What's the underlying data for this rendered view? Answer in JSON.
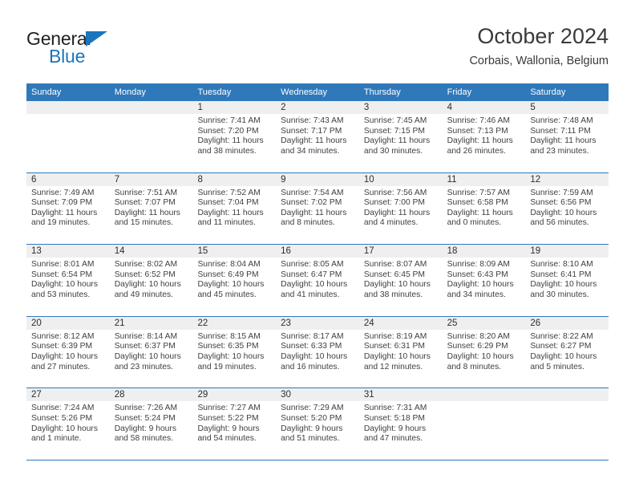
{
  "brand": {
    "name_part1": "General",
    "name_part2": "Blue",
    "accent_color": "#1b75bc",
    "logo_icon": "triangle-flag-icon"
  },
  "header": {
    "title": "October 2024",
    "subtitle": "Corbais, Wallonia, Belgium"
  },
  "calendar": {
    "header_color": "#2f78ba",
    "weekdays": [
      "Sunday",
      "Monday",
      "Tuesday",
      "Wednesday",
      "Thursday",
      "Friday",
      "Saturday"
    ],
    "weeks": [
      [
        {
          "day": "",
          "sunrise": "",
          "sunset": "",
          "daylight": "",
          "daylight2": ""
        },
        {
          "day": "",
          "sunrise": "",
          "sunset": "",
          "daylight": "",
          "daylight2": ""
        },
        {
          "day": "1",
          "sunrise": "Sunrise: 7:41 AM",
          "sunset": "Sunset: 7:20 PM",
          "daylight": "Daylight: 11 hours",
          "daylight2": "and 38 minutes."
        },
        {
          "day": "2",
          "sunrise": "Sunrise: 7:43 AM",
          "sunset": "Sunset: 7:17 PM",
          "daylight": "Daylight: 11 hours",
          "daylight2": "and 34 minutes."
        },
        {
          "day": "3",
          "sunrise": "Sunrise: 7:45 AM",
          "sunset": "Sunset: 7:15 PM",
          "daylight": "Daylight: 11 hours",
          "daylight2": "and 30 minutes."
        },
        {
          "day": "4",
          "sunrise": "Sunrise: 7:46 AM",
          "sunset": "Sunset: 7:13 PM",
          "daylight": "Daylight: 11 hours",
          "daylight2": "and 26 minutes."
        },
        {
          "day": "5",
          "sunrise": "Sunrise: 7:48 AM",
          "sunset": "Sunset: 7:11 PM",
          "daylight": "Daylight: 11 hours",
          "daylight2": "and 23 minutes."
        }
      ],
      [
        {
          "day": "6",
          "sunrise": "Sunrise: 7:49 AM",
          "sunset": "Sunset: 7:09 PM",
          "daylight": "Daylight: 11 hours",
          "daylight2": "and 19 minutes."
        },
        {
          "day": "7",
          "sunrise": "Sunrise: 7:51 AM",
          "sunset": "Sunset: 7:07 PM",
          "daylight": "Daylight: 11 hours",
          "daylight2": "and 15 minutes."
        },
        {
          "day": "8",
          "sunrise": "Sunrise: 7:52 AM",
          "sunset": "Sunset: 7:04 PM",
          "daylight": "Daylight: 11 hours",
          "daylight2": "and 11 minutes."
        },
        {
          "day": "9",
          "sunrise": "Sunrise: 7:54 AM",
          "sunset": "Sunset: 7:02 PM",
          "daylight": "Daylight: 11 hours",
          "daylight2": "and 8 minutes."
        },
        {
          "day": "10",
          "sunrise": "Sunrise: 7:56 AM",
          "sunset": "Sunset: 7:00 PM",
          "daylight": "Daylight: 11 hours",
          "daylight2": "and 4 minutes."
        },
        {
          "day": "11",
          "sunrise": "Sunrise: 7:57 AM",
          "sunset": "Sunset: 6:58 PM",
          "daylight": "Daylight: 11 hours",
          "daylight2": "and 0 minutes."
        },
        {
          "day": "12",
          "sunrise": "Sunrise: 7:59 AM",
          "sunset": "Sunset: 6:56 PM",
          "daylight": "Daylight: 10 hours",
          "daylight2": "and 56 minutes."
        }
      ],
      [
        {
          "day": "13",
          "sunrise": "Sunrise: 8:01 AM",
          "sunset": "Sunset: 6:54 PM",
          "daylight": "Daylight: 10 hours",
          "daylight2": "and 53 minutes."
        },
        {
          "day": "14",
          "sunrise": "Sunrise: 8:02 AM",
          "sunset": "Sunset: 6:52 PM",
          "daylight": "Daylight: 10 hours",
          "daylight2": "and 49 minutes."
        },
        {
          "day": "15",
          "sunrise": "Sunrise: 8:04 AM",
          "sunset": "Sunset: 6:49 PM",
          "daylight": "Daylight: 10 hours",
          "daylight2": "and 45 minutes."
        },
        {
          "day": "16",
          "sunrise": "Sunrise: 8:05 AM",
          "sunset": "Sunset: 6:47 PM",
          "daylight": "Daylight: 10 hours",
          "daylight2": "and 41 minutes."
        },
        {
          "day": "17",
          "sunrise": "Sunrise: 8:07 AM",
          "sunset": "Sunset: 6:45 PM",
          "daylight": "Daylight: 10 hours",
          "daylight2": "and 38 minutes."
        },
        {
          "day": "18",
          "sunrise": "Sunrise: 8:09 AM",
          "sunset": "Sunset: 6:43 PM",
          "daylight": "Daylight: 10 hours",
          "daylight2": "and 34 minutes."
        },
        {
          "day": "19",
          "sunrise": "Sunrise: 8:10 AM",
          "sunset": "Sunset: 6:41 PM",
          "daylight": "Daylight: 10 hours",
          "daylight2": "and 30 minutes."
        }
      ],
      [
        {
          "day": "20",
          "sunrise": "Sunrise: 8:12 AM",
          "sunset": "Sunset: 6:39 PM",
          "daylight": "Daylight: 10 hours",
          "daylight2": "and 27 minutes."
        },
        {
          "day": "21",
          "sunrise": "Sunrise: 8:14 AM",
          "sunset": "Sunset: 6:37 PM",
          "daylight": "Daylight: 10 hours",
          "daylight2": "and 23 minutes."
        },
        {
          "day": "22",
          "sunrise": "Sunrise: 8:15 AM",
          "sunset": "Sunset: 6:35 PM",
          "daylight": "Daylight: 10 hours",
          "daylight2": "and 19 minutes."
        },
        {
          "day": "23",
          "sunrise": "Sunrise: 8:17 AM",
          "sunset": "Sunset: 6:33 PM",
          "daylight": "Daylight: 10 hours",
          "daylight2": "and 16 minutes."
        },
        {
          "day": "24",
          "sunrise": "Sunrise: 8:19 AM",
          "sunset": "Sunset: 6:31 PM",
          "daylight": "Daylight: 10 hours",
          "daylight2": "and 12 minutes."
        },
        {
          "day": "25",
          "sunrise": "Sunrise: 8:20 AM",
          "sunset": "Sunset: 6:29 PM",
          "daylight": "Daylight: 10 hours",
          "daylight2": "and 8 minutes."
        },
        {
          "day": "26",
          "sunrise": "Sunrise: 8:22 AM",
          "sunset": "Sunset: 6:27 PM",
          "daylight": "Daylight: 10 hours",
          "daylight2": "and 5 minutes."
        }
      ],
      [
        {
          "day": "27",
          "sunrise": "Sunrise: 7:24 AM",
          "sunset": "Sunset: 5:26 PM",
          "daylight": "Daylight: 10 hours",
          "daylight2": "and 1 minute."
        },
        {
          "day": "28",
          "sunrise": "Sunrise: 7:26 AM",
          "sunset": "Sunset: 5:24 PM",
          "daylight": "Daylight: 9 hours",
          "daylight2": "and 58 minutes."
        },
        {
          "day": "29",
          "sunrise": "Sunrise: 7:27 AM",
          "sunset": "Sunset: 5:22 PM",
          "daylight": "Daylight: 9 hours",
          "daylight2": "and 54 minutes."
        },
        {
          "day": "30",
          "sunrise": "Sunrise: 7:29 AM",
          "sunset": "Sunset: 5:20 PM",
          "daylight": "Daylight: 9 hours",
          "daylight2": "and 51 minutes."
        },
        {
          "day": "31",
          "sunrise": "Sunrise: 7:31 AM",
          "sunset": "Sunset: 5:18 PM",
          "daylight": "Daylight: 9 hours",
          "daylight2": "and 47 minutes."
        },
        {
          "day": "",
          "sunrise": "",
          "sunset": "",
          "daylight": "",
          "daylight2": ""
        },
        {
          "day": "",
          "sunrise": "",
          "sunset": "",
          "daylight": "",
          "daylight2": ""
        }
      ]
    ]
  }
}
